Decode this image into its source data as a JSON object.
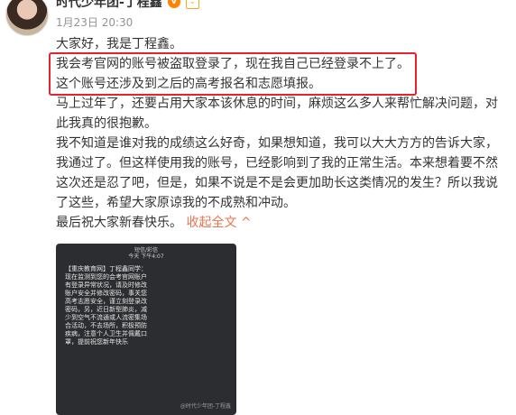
{
  "author": {
    "name": "时代少年团-丁程鑫",
    "verified_icon": "verified-icon",
    "badge_icon": "chevron-down-icon"
  },
  "meta": {
    "date": "1月23日",
    "time": "20:30"
  },
  "content": {
    "lines": [
      "大家好，我是丁程鑫。",
      "我会考官网的账号被盗取登录了，现在我自己已经登录不上了。",
      "这个账号还涉及到之后的高考报名和志愿填报。",
      "马上过年了，还要占用大家本该休息的时间，麻烦这么多人来帮忙解决问题，对",
      "此我真的很抱歉。",
      "我不知道是谁对我的成绩这么好奇，如果想知道，我可以大大方方的告诉大家，",
      "我通过了。但这样使用我的账号，已经影响到了我的正常生活。本来想着要不然",
      "这次还是忍了吧，但是，如果不说是不是会更加助长这类情况的发生？所以我说",
      "了这些，希望大家原谅我的不成熟和冲动。"
    ],
    "last_line": "最后祝大家新春快乐。",
    "collapse_label": "收起全文",
    "collapse_icon": "^"
  },
  "image": {
    "top_line1": "短信/彩信",
    "top_line2": "今天 下午4:07",
    "message_lines": [
      "【重庆教育网】丁程鑫同学：",
      "现在监测到您的会考官网账户",
      "有登录异常状况，请及时修改",
      "账户安全并修改密码，事关您",
      "高考志愿安全，谨立刻登录改",
      "密码，另，近日新型肺炎，减",
      "少到空气不流通或人流密集场",
      "合活动，不去场所，积极预防",
      "疾病，注意个人卫生并佩戴口",
      "罩，提前祝您新年快乐"
    ],
    "watermark": "@时代少年团-丁程鑫"
  },
  "colors": {
    "highlight_border": "#e8212b",
    "link": "#eb7350",
    "verified": "#ff8200"
  }
}
